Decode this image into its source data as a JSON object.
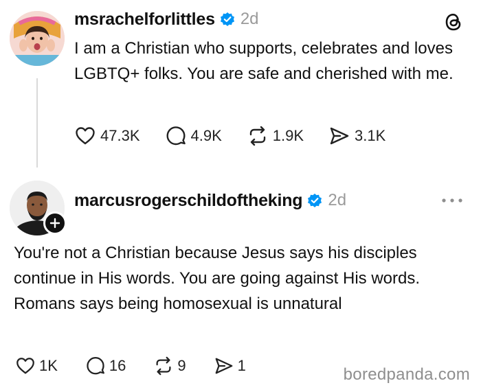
{
  "post": {
    "username": "msrachelforlittles",
    "time": "2d",
    "text": "I am a Christian who supports, celebrates and loves LGBTQ+ folks. You are safe and cherished with me.",
    "likes": "47.3K",
    "comments": "4.9K",
    "reposts": "1.9K",
    "shares": "3.1K"
  },
  "reply": {
    "username": "marcusrogerschildoftheking",
    "time": "2d",
    "text": "You're not a Christian because Jesus says his disciples continue in His words. You are going against His words. Romans says being homosexual is unnatural",
    "likes": "1K",
    "comments": "16",
    "reposts": "9",
    "shares": "1"
  },
  "watermark": "boredpanda.com",
  "colors": {
    "verified_badge": "#0095f6",
    "timestamp": "#9a9a9a",
    "thread_line": "#d9d9d9"
  },
  "icons": [
    "heart-icon",
    "comment-icon",
    "repost-icon",
    "share-icon",
    "threads-logo-icon",
    "more-options-icon",
    "verified-badge-icon",
    "plus-icon"
  ]
}
